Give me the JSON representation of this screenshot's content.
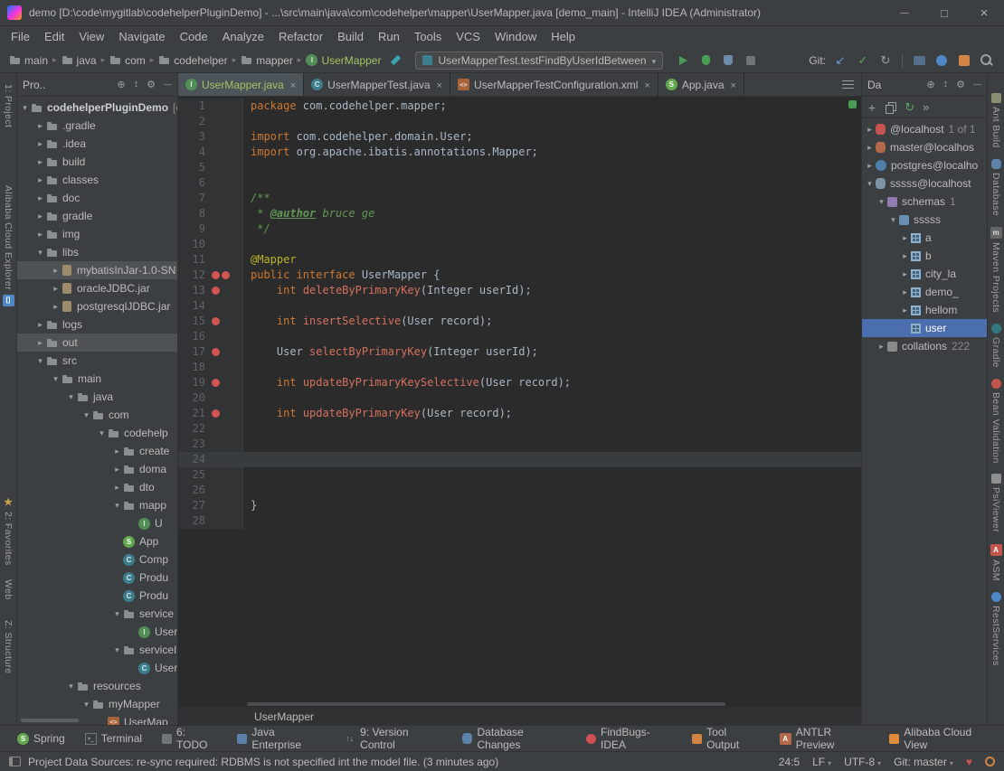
{
  "title_bar": {
    "title": "demo [D:\\code\\mygitlab\\codehelperPluginDemo] - ...\\src\\main\\java\\com\\codehelper\\mapper\\UserMapper.java [demo_main] - IntelliJ IDEA (Administrator)"
  },
  "menu_bar": {
    "items": [
      "File",
      "Edit",
      "View",
      "Navigate",
      "Code",
      "Analyze",
      "Refactor",
      "Build",
      "Run",
      "Tools",
      "VCS",
      "Window",
      "Help"
    ]
  },
  "toolbar": {
    "breadcrumbs": [
      {
        "label": "main",
        "icon": "folder"
      },
      {
        "label": "java",
        "icon": "folder"
      },
      {
        "label": "com",
        "icon": "folder"
      },
      {
        "label": "codehelper",
        "icon": "folder"
      },
      {
        "label": "mapper",
        "icon": "folder"
      },
      {
        "label": "UserMapper",
        "icon": "interface",
        "green": true
      }
    ],
    "run_config": {
      "label": "UserMapperTest.testFindByUserIdBetween"
    },
    "git_label": "Git:"
  },
  "left_stripe": {
    "items": [
      {
        "label": "1: Project"
      },
      {
        "label": "Alibaba Cloud Explorer",
        "icon": "alibaba-exp",
        "icon_after": true
      },
      {
        "label": "2: Favorites",
        "icon": "star"
      },
      {
        "label": "Web"
      },
      {
        "label": "Z: Structure"
      }
    ]
  },
  "project_panel": {
    "header": {
      "title": "Pro..",
      "icons": [
        "target",
        "updown",
        "gear",
        "hide"
      ]
    },
    "tree": [
      {
        "label": "codehelperPluginDemo",
        "suffix": "[c",
        "d": 0,
        "icon": "folder",
        "arrow": "open"
      },
      {
        "label": ".gradle",
        "d": 1,
        "icon": "folder",
        "arrow": "closed"
      },
      {
        "label": ".idea",
        "d": 1,
        "icon": "folder",
        "arrow": "closed"
      },
      {
        "label": "build",
        "d": 1,
        "icon": "folder",
        "arrow": "closed"
      },
      {
        "label": "classes",
        "d": 1,
        "icon": "folder",
        "arrow": "closed"
      },
      {
        "label": "doc",
        "d": 1,
        "icon": "folder",
        "arrow": "closed"
      },
      {
        "label": "gradle",
        "d": 1,
        "icon": "folder",
        "arrow": "closed"
      },
      {
        "label": "img",
        "d": 1,
        "icon": "folder",
        "arrow": "closed"
      },
      {
        "label": "libs",
        "d": 1,
        "icon": "folder",
        "arrow": "open"
      },
      {
        "label": "mybatisInJar-1.0-SN",
        "d": 2,
        "icon": "jar",
        "arrow": "closed",
        "sel": "gray"
      },
      {
        "label": "oracleJDBC.jar",
        "d": 2,
        "icon": "jar",
        "arrow": "closed"
      },
      {
        "label": "postgresqlJDBC.jar",
        "d": 2,
        "icon": "jar",
        "arrow": "closed"
      },
      {
        "label": "logs",
        "d": 1,
        "icon": "folder",
        "arrow": "closed"
      },
      {
        "label": "out",
        "d": 1,
        "icon": "folder",
        "arrow": "closed",
        "sel": "gray"
      },
      {
        "label": "src",
        "d": 1,
        "icon": "folder",
        "arrow": "open"
      },
      {
        "label": "main",
        "d": 2,
        "icon": "folder",
        "arrow": "open"
      },
      {
        "label": "java",
        "d": 3,
        "icon": "folder",
        "arrow": "open"
      },
      {
        "label": "com",
        "d": 4,
        "icon": "folder",
        "arrow": "open"
      },
      {
        "label": "codehelp",
        "d": 5,
        "icon": "folder",
        "arrow": "open"
      },
      {
        "label": "create",
        "d": 6,
        "icon": "folder",
        "arrow": "closed"
      },
      {
        "label": "doma",
        "d": 6,
        "icon": "folder",
        "arrow": "closed"
      },
      {
        "label": "dto",
        "d": 6,
        "icon": "folder",
        "arrow": "closed"
      },
      {
        "label": "mapp",
        "d": 6,
        "icon": "folder",
        "arrow": "open"
      },
      {
        "label": "U",
        "d": 7,
        "icon": "interface"
      },
      {
        "label": "App",
        "d": 6,
        "icon": "spring"
      },
      {
        "label": "Comp",
        "d": 6,
        "icon": "class"
      },
      {
        "label": "Produ",
        "d": 6,
        "icon": "class"
      },
      {
        "label": "Produ",
        "d": 6,
        "icon": "class"
      },
      {
        "label": "service",
        "d": 6,
        "icon": "folder",
        "arrow": "open"
      },
      {
        "label": "UserS",
        "d": 7,
        "icon": "interface"
      },
      {
        "label": "serviceIm",
        "d": 6,
        "icon": "folder",
        "arrow": "open"
      },
      {
        "label": "UserS",
        "d": 7,
        "icon": "class"
      },
      {
        "label": "resources",
        "d": 3,
        "icon": "folder",
        "arrow": "open"
      },
      {
        "label": "myMapper",
        "d": 4,
        "icon": "folder",
        "arrow": "open"
      },
      {
        "label": "UserMap",
        "d": 5,
        "icon": "xml"
      }
    ]
  },
  "editor": {
    "tabs": [
      {
        "label": "UserMapper.java",
        "icon": "interface",
        "selected": true
      },
      {
        "label": "UserMapperTest.java",
        "icon": "class",
        "selected": false
      },
      {
        "label": "UserMapperTestConfiguration.xml",
        "icon": "xml",
        "selected": false
      },
      {
        "label": "App.java",
        "icon": "spring",
        "selected": false
      }
    ],
    "breadcrumb": "UserMapper",
    "caret_line": 24,
    "lines": [
      {
        "n": 1,
        "s": [
          [
            "kw",
            "package"
          ],
          [
            "pl",
            " com.codehelper.mapper;"
          ]
        ]
      },
      {
        "n": 2,
        "s": []
      },
      {
        "n": 3,
        "s": [
          [
            "kw",
            "import"
          ],
          [
            "pl",
            " com.codehelper.domain.User;"
          ]
        ]
      },
      {
        "n": 4,
        "s": [
          [
            "kw",
            "import"
          ],
          [
            "pl",
            " org.apache.ibatis.annotations.Mapper;"
          ]
        ]
      },
      {
        "n": 5,
        "s": []
      },
      {
        "n": 6,
        "s": []
      },
      {
        "n": 7,
        "s": [
          [
            "cm",
            "/**"
          ]
        ]
      },
      {
        "n": 8,
        "s": [
          [
            "cm",
            " * "
          ],
          [
            "tag",
            "@author"
          ],
          [
            "cmi",
            " bruce ge"
          ]
        ]
      },
      {
        "n": 9,
        "s": [
          [
            "cm",
            " */"
          ]
        ]
      },
      {
        "n": 10,
        "s": []
      },
      {
        "n": 11,
        "s": [
          [
            "ann",
            "@Mapper"
          ]
        ]
      },
      {
        "n": 12,
        "s": [
          [
            "kw",
            "public interface"
          ],
          [
            "pl",
            " UserMapper {"
          ]
        ],
        "bp": 2
      },
      {
        "n": 13,
        "s": [
          [
            "pl",
            "    "
          ],
          [
            "kw",
            "int"
          ],
          [
            "mth",
            " deleteByPrimaryKey"
          ],
          [
            "pl",
            "(Integer userId);"
          ]
        ],
        "bp": 1
      },
      {
        "n": 14,
        "s": []
      },
      {
        "n": 15,
        "s": [
          [
            "pl",
            "    "
          ],
          [
            "kw",
            "int"
          ],
          [
            "mth",
            " insertSelective"
          ],
          [
            "pl",
            "(User record);"
          ]
        ],
        "bp": 1
      },
      {
        "n": 16,
        "s": []
      },
      {
        "n": 17,
        "s": [
          [
            "pl",
            "    User "
          ],
          [
            "mth",
            "selectByPrimaryKey"
          ],
          [
            "pl",
            "(Integer userId);"
          ]
        ],
        "bp": 1
      },
      {
        "n": 18,
        "s": []
      },
      {
        "n": 19,
        "s": [
          [
            "pl",
            "    "
          ],
          [
            "kw",
            "int"
          ],
          [
            "mth",
            " updateByPrimaryKeySelective"
          ],
          [
            "pl",
            "(User record);"
          ]
        ],
        "bp": 1
      },
      {
        "n": 20,
        "s": []
      },
      {
        "n": 21,
        "s": [
          [
            "pl",
            "    "
          ],
          [
            "kw",
            "int"
          ],
          [
            "mth",
            " updateByPrimaryKey"
          ],
          [
            "pl",
            "(User record);"
          ]
        ],
        "bp": 1
      },
      {
        "n": 22,
        "s": []
      },
      {
        "n": 23,
        "s": []
      },
      {
        "n": 24,
        "s": []
      },
      {
        "n": 25,
        "s": []
      },
      {
        "n": 26,
        "s": []
      },
      {
        "n": 27,
        "s": [
          [
            "pl",
            "}"
          ]
        ]
      },
      {
        "n": 28,
        "s": []
      }
    ]
  },
  "db_panel": {
    "header": {
      "title": "Da",
      "icons": [
        "target",
        "updown",
        "gear",
        "hide"
      ]
    },
    "toolbar_icons": [
      "add",
      "duplicate",
      "sync",
      "chevrons"
    ],
    "tree": [
      {
        "label": "@localhost",
        "suffix": "1 of 1",
        "d": 0,
        "icon": "db-red",
        "arrow": "closed"
      },
      {
        "label": "master@localhos",
        "d": 0,
        "icon": "db-mysql",
        "arrow": "closed"
      },
      {
        "label": "postgres@localho",
        "d": 0,
        "icon": "db-postgres",
        "arrow": "closed"
      },
      {
        "label": "sssss@localhost",
        "d": 0,
        "icon": "db-sqlite",
        "arrow": "open"
      },
      {
        "label": "schemas",
        "suffix": "1",
        "d": 1,
        "icon": "schemas",
        "arrow": "open"
      },
      {
        "label": "sssss",
        "d": 2,
        "icon": "schema",
        "arrow": "open"
      },
      {
        "label": "a",
        "d": 3,
        "icon": "table",
        "arrow": "closed"
      },
      {
        "label": "b",
        "d": 3,
        "icon": "table",
        "arrow": "closed"
      },
      {
        "label": "city_la",
        "d": 3,
        "icon": "table",
        "arrow": "closed"
      },
      {
        "label": "demo_",
        "d": 3,
        "icon": "table",
        "arrow": "closed"
      },
      {
        "label": "hellom",
        "d": 3,
        "icon": "table",
        "arrow": "closed"
      },
      {
        "label": "user",
        "d": 3,
        "icon": "table",
        "sel": "blue"
      },
      {
        "label": "collations",
        "suffix": "222",
        "d": 1,
        "icon": "collations",
        "arrow": "closed"
      }
    ]
  },
  "right_stripe": {
    "items": [
      {
        "label": "Ant Build",
        "icon": "ant"
      },
      {
        "label": "Database",
        "icon": "db-tool"
      },
      {
        "label": "Maven Projects",
        "icon": "maven"
      },
      {
        "label": "Gradle",
        "icon": "gradle"
      },
      {
        "label": "Bean Validation",
        "icon": "bean"
      },
      {
        "label": "PsiViewer",
        "icon": "psi"
      },
      {
        "label": "ASM",
        "icon": "asm"
      },
      {
        "label": "RestServices",
        "icon": "rest"
      }
    ]
  },
  "bottom_bar": {
    "items": [
      {
        "label": "Spring",
        "icon": "spring"
      },
      {
        "label": "Terminal",
        "icon": "terminal"
      },
      {
        "label": "6: TODO",
        "icon": "todo"
      },
      {
        "label": "Java Enterprise",
        "icon": "javaee"
      },
      {
        "label": "9: Version Control",
        "icon": "vcs"
      },
      {
        "label": "Database Changes",
        "icon": "db-tool"
      },
      {
        "label": "FindBugs-IDEA",
        "icon": "bug"
      },
      {
        "label": "Tool Output",
        "icon": "tool"
      },
      {
        "label": "ANTLR Preview",
        "icon": "antlr"
      },
      {
        "label": "Alibaba Cloud View",
        "icon": "alibaba"
      }
    ]
  },
  "status_bar": {
    "message": "Project Data Sources: re-sync required: RDBMS is not specified int the model file. (3 minutes ago)",
    "caret": "24:5",
    "line_sep": "LF",
    "encoding": "UTF-8",
    "git_branch": "Git: master"
  }
}
